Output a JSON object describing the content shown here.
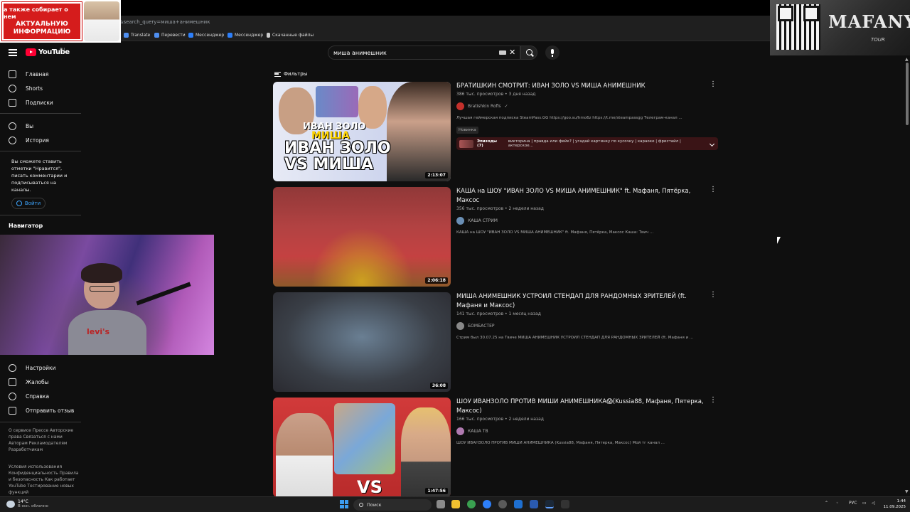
{
  "browser": {
    "url_fragment": "&search_query=миша+анимешник",
    "bookmarks": [
      {
        "label": "Translate",
        "color": "#4f8ff0"
      },
      {
        "label": "Перевести",
        "color": "#4f8ff0"
      },
      {
        "label": "Мессенджер",
        "color": "#2d7ff9"
      },
      {
        "label": "Мессенджер",
        "color": "#2d7ff9"
      },
      {
        "label": "Скачанные файлы",
        "color": "#cccccc"
      }
    ]
  },
  "overlay": {
    "promo_line1": "а также собирает о нем",
    "promo_line2": "АКТУАЛЬНУЮ",
    "promo_line3": "ИНФОРМАЦИЮ",
    "tour_title": "MAFANYA",
    "tour_sub": "TOUR"
  },
  "header": {
    "logo_text": "YouTube",
    "region": "RU",
    "search_value": "миша анимешник"
  },
  "sidebar": {
    "primary": [
      {
        "label": "Главная",
        "icon": "home-icon"
      },
      {
        "label": "Shorts",
        "icon": "shorts-icon"
      },
      {
        "label": "Подписки",
        "icon": "subscriptions-icon"
      }
    ],
    "secondary": [
      {
        "label": "Вы",
        "icon": "user-icon"
      },
      {
        "label": "История",
        "icon": "history-icon"
      }
    ],
    "signin_note": "Вы сможете ставить отметки \"Нравится\", писать комментарии и подписываться на каналы.",
    "signin_label": "Войти",
    "navigator_label": "Навигатор",
    "bottom": [
      {
        "label": "Настройки",
        "icon": "gear-icon"
      },
      {
        "label": "Жалобы",
        "icon": "flag-icon"
      },
      {
        "label": "Справка",
        "icon": "help-icon"
      },
      {
        "label": "Отправить отзыв",
        "icon": "feedback-icon"
      }
    ],
    "footer1": "О сервисе  Прессе  Авторские права  Связаться с нами  Авторам  Рекламодателям  Разработчикам",
    "footer2": "Условия использования  Конфиденциальность  Правила и безопасность  Как работает YouTube  Тестирование новых функций"
  },
  "filters_label": "Фильтры",
  "results": [
    {
      "title": "БРАТИШКИН СМОТРИТ: ИВАН ЗОЛО VS МИША АНИМЕШНИК",
      "meta": "386 тыс. просмотров • 3 дня назад",
      "channel": "Bratishkin Rofls",
      "channel_color": "#c4302b",
      "desc": "Лучшая геймерская подписка SteamPass.GG https://goo.su/hmo6z https://t.me/steampassgg Телеграм-канал ...",
      "badge": "Новинка",
      "duration": "2:13:07",
      "thumb_text1": "ИВАН ЗОЛО",
      "thumb_text2": "МИША",
      "thumb_text3": "ИВАН ЗОЛО",
      "thumb_text4": "VS МИША",
      "episodes_label": "Эпизоды (7)",
      "episodes_text": "викторина | правда или фейк? | угадай картинку по кусочку | караоке | фристайл | актерское..."
    },
    {
      "title": "КАША на ШОУ \"ИВАН ЗОЛО VS МИША АНИМЕШНИК\" ft. Мафаня, Пятёрка, Максос",
      "meta": "356 тыс. просмотров • 2 недели назад",
      "channel": "КАША СТРИМ",
      "channel_color": "#6a8fb5",
      "desc": "КАША на ШОУ \"ИВАН ЗОЛО VS МИША АНИМЕШНИК\" ft. Мафаня, Пятёрка, Максос Каша: Твич ...",
      "duration": "2:06:18"
    },
    {
      "title": "МИША АНИМЕШНИК УСТРОИЛ СТЕНДАП ДЛЯ РАНДОМНЫХ ЗРИТЕЛЕЙ (ft. Мафаня и Максос)",
      "meta": "141 тыс. просмотров • 1 месяц назад",
      "channel": "БОМБАСТЕР",
      "channel_color": "#888888",
      "desc": "Стрим был 30.07.25 на Твиче МИША АНИМЕШНИК УСТРОИЛ СТЕНДАП ДЛЯ РАНДОМНЫХ ЗРИТЕЛЕЙ (ft. Мафаня и ...",
      "duration": "36:08"
    },
    {
      "title": "ШОУ ИВАНЗОЛО ПРОТИВ МИШИ АНИМЕШНИКА😱(Kussia88, Мафаня, Пятерка, Максос)",
      "meta": "166 тыс. просмотров • 2 недели назад",
      "channel": "КАША ТВ",
      "channel_color": "#b07ab0",
      "desc": "ШОУ ИВАНЗОЛО ПРОТИВ МИШИ АНИМЕШНИКА (Kussia88, Мафаня, Пятерка, Максос) Мой тг канал ...",
      "duration": "1:47:56",
      "thumb_text": "VS"
    }
  ],
  "taskbar": {
    "temp": "14°C",
    "weather_desc": "В осн. облачно",
    "search_label": "Поиск",
    "lang": "РУС",
    "time": "1:44",
    "date": "11.09.2025"
  }
}
